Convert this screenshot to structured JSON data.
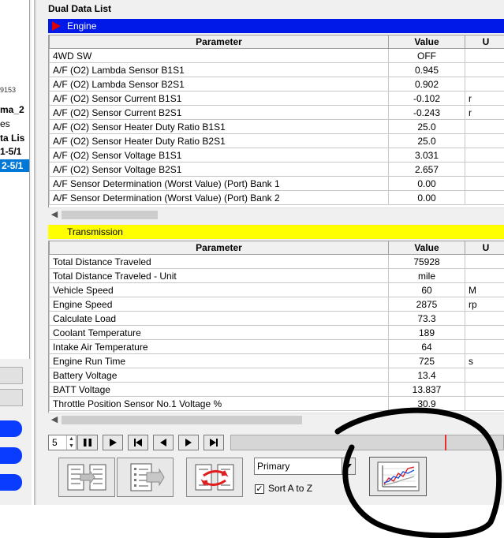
{
  "left_tree": {
    "items": [
      {
        "text": "9153"
      },
      {
        "text": "ma_2"
      },
      {
        "text": "es"
      },
      {
        "text": "ta Lis"
      },
      {
        "text": "1-5/1"
      },
      {
        "text": "2-5/1"
      }
    ]
  },
  "main": {
    "title": "Dual Data List"
  },
  "engine": {
    "label": "Engine",
    "color": "#0019e8",
    "headers": {
      "parameter": "Parameter",
      "value": "Value",
      "unit": "U"
    },
    "rows": [
      {
        "parameter": "4WD SW",
        "value": "OFF",
        "unit": ""
      },
      {
        "parameter": "A/F (O2) Lambda Sensor B1S1",
        "value": "0.945",
        "unit": ""
      },
      {
        "parameter": "A/F (O2) Lambda Sensor B2S1",
        "value": "0.902",
        "unit": ""
      },
      {
        "parameter": "A/F (O2) Sensor Current B1S1",
        "value": "-0.102",
        "unit": "r"
      },
      {
        "parameter": "A/F (O2) Sensor Current B2S1",
        "value": "-0.243",
        "unit": "r"
      },
      {
        "parameter": "A/F (O2) Sensor Heater Duty Ratio B1S1",
        "value": "25.0",
        "unit": ""
      },
      {
        "parameter": "A/F (O2) Sensor Heater Duty Ratio B2S1",
        "value": "25.0",
        "unit": ""
      },
      {
        "parameter": "A/F (O2) Sensor Voltage B1S1",
        "value": "3.031",
        "unit": ""
      },
      {
        "parameter": "A/F (O2) Sensor Voltage B2S1",
        "value": "2.657",
        "unit": ""
      },
      {
        "parameter": "A/F Sensor Determination (Worst Value) (Port) Bank 1",
        "value": "0.00",
        "unit": ""
      },
      {
        "parameter": "A/F Sensor Determination (Worst Value) (Port) Bank 2",
        "value": "0.00",
        "unit": ""
      }
    ]
  },
  "transmission": {
    "label": "Transmission",
    "color": "#ffff00",
    "headers": {
      "parameter": "Parameter",
      "value": "Value",
      "unit": "U"
    },
    "rows": [
      {
        "parameter": "Total Distance Traveled",
        "value": "75928",
        "unit": ""
      },
      {
        "parameter": "Total Distance Traveled - Unit",
        "value": "mile",
        "unit": ""
      },
      {
        "parameter": "Vehicle Speed",
        "value": "60",
        "unit": "M"
      },
      {
        "parameter": "Engine Speed",
        "value": "2875",
        "unit": "rp"
      },
      {
        "parameter": "Calculate Load",
        "value": "73.3",
        "unit": ""
      },
      {
        "parameter": "Coolant Temperature",
        "value": "189",
        "unit": ""
      },
      {
        "parameter": "Intake Air Temperature",
        "value": "64",
        "unit": ""
      },
      {
        "parameter": "Engine Run Time",
        "value": "725",
        "unit": "s"
      },
      {
        "parameter": "Battery Voltage",
        "value": "13.4",
        "unit": ""
      },
      {
        "parameter": "BATT Voltage",
        "value": "13.837",
        "unit": ""
      },
      {
        "parameter": "Throttle Position Sensor No.1 Voltage %",
        "value": "30.9",
        "unit": ""
      }
    ]
  },
  "player": {
    "speed": "5",
    "buttons": [
      "pause-icon",
      "play-icon",
      "skip-to-start-icon",
      "step-back-icon",
      "step-forward-icon",
      "skip-to-end-icon"
    ]
  },
  "controls": {
    "dropdown_value": "Primary",
    "sort_label": "Sort A to Z",
    "sort_checked": true
  },
  "annotation": {
    "color": "#000000"
  }
}
